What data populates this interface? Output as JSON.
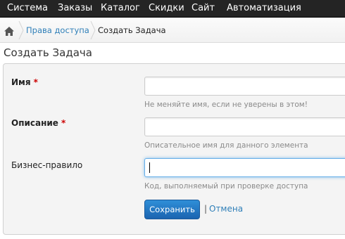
{
  "top_nav": {
    "items": [
      "Система",
      "Заказы",
      "Каталог",
      "Скидки",
      "Сайт",
      "Автоматизация"
    ]
  },
  "breadcrumb": {
    "home_icon": "home-icon",
    "link": "Права доступа",
    "current": "Создать Задача"
  },
  "page": {
    "title": "Создать Задача"
  },
  "form": {
    "name": {
      "label": "Имя",
      "required_mark": "*",
      "value": "",
      "help": "Не меняйте имя, если не уверены в этом!"
    },
    "description": {
      "label": "Описание",
      "required_mark": "*",
      "value": "",
      "help": "Описательное имя для данного элемента"
    },
    "business_rule": {
      "label": "Бизнес-правило",
      "value": "",
      "help": "Код, выполняемый при проверке доступа"
    },
    "save_label": "Сохранить",
    "separator": "|",
    "cancel_label": "Отмена"
  },
  "colors": {
    "nav_bg": "#242424",
    "link": "#2f7fb8",
    "primary_button": "#1f6fbf",
    "required": "#cc0000"
  }
}
